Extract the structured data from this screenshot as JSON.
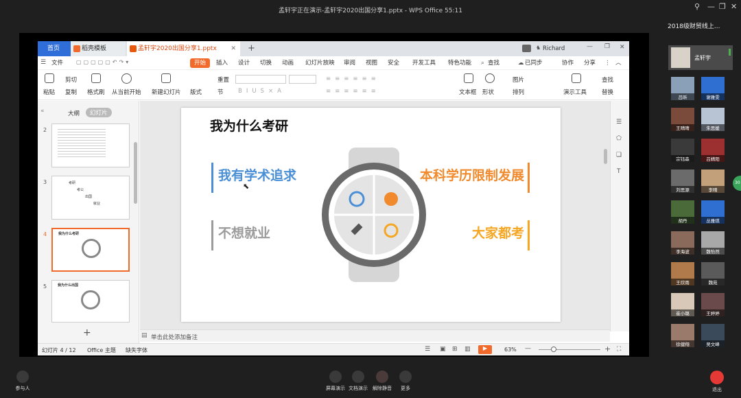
{
  "window": {
    "title": "孟轩宇正在演示-孟轩宇2020出国分享1.pptx - WPS Office 55:11"
  },
  "meeting": {
    "group_name": "2018级财贸线上..."
  },
  "wps": {
    "tabs": [
      {
        "label": "首页"
      },
      {
        "label": "稻壳模板"
      },
      {
        "label": "孟轩宇2020出国分享1.pptx"
      }
    ],
    "user": "Richard",
    "menus": [
      "文件",
      "开始",
      "插入",
      "设计",
      "切换",
      "动画",
      "幻灯片放映",
      "审阅",
      "视图",
      "安全",
      "开发工具",
      "特色功能"
    ],
    "search_label": "查找",
    "sync_label": "已同步",
    "collab_label": "协作",
    "share_label": "分享",
    "toolbar": {
      "paste": "粘贴",
      "cut": "剪切",
      "copy": "复制",
      "format_painter": "格式刷",
      "from_current": "从当前开始",
      "new_slide": "新建幻灯片",
      "layout": "版式",
      "section": "节",
      "reset": "重置",
      "textbox": "文本框",
      "shape": "形状",
      "picture": "图片",
      "arrange": "排列",
      "present_tools": "演示工具",
      "find": "查找",
      "replace": "替换"
    },
    "panel_tabs": [
      "大纲",
      "幻灯片"
    ],
    "thumbs": [
      {
        "num": "2"
      },
      {
        "num": "3"
      },
      {
        "num": "4"
      },
      {
        "num": "5"
      }
    ],
    "thumb4_title": "我为什么考研",
    "thumb5_title": "我为什么出国",
    "thumb3_items": [
      "考研",
      "考公",
      "出国",
      "就业"
    ],
    "slide": {
      "title": "我为什么考研",
      "left_top": "我有学术追求",
      "left_bottom": "不想就业",
      "right_top": "本科学历限制发展",
      "right_bottom": "大家都考"
    },
    "notes_placeholder": "单击此处添加备注",
    "status": {
      "slide_count": "幻灯片 4 / 12",
      "theme": "Office 主题",
      "missing_font": "缺失字体",
      "zoom": "63%"
    }
  },
  "participants": [
    {
      "name": "孟轩宇"
    },
    {
      "name": "吕昕"
    },
    {
      "name": "谢雅雯"
    },
    {
      "name": "王晴晴"
    },
    {
      "name": "朱思媛"
    },
    {
      "name": "宗钰森"
    },
    {
      "name": "吕婧阳"
    },
    {
      "name": "刘思源"
    },
    {
      "name": "李晴"
    },
    {
      "name": "胡丹"
    },
    {
      "name": "丛雅琪"
    },
    {
      "name": "李海波"
    },
    {
      "name": "魏怡然"
    },
    {
      "name": "王欣雨"
    },
    {
      "name": "魏苑"
    },
    {
      "name": "崔小璐"
    },
    {
      "name": "王婷婷"
    },
    {
      "name": "徐健翔"
    },
    {
      "name": "吴文峰"
    }
  ],
  "bottom": {
    "participants": "参与人",
    "screen_share": "屏幕演示",
    "doc_share": "文档演示",
    "unmute": "解除静音",
    "more": "更多",
    "exit": "退出"
  },
  "colors": {
    "blue": "#4a8fd6",
    "orange": "#f08a2c",
    "gold": "#f5a623",
    "gray": "#9b9b9b",
    "accent": "#f26a2b"
  }
}
